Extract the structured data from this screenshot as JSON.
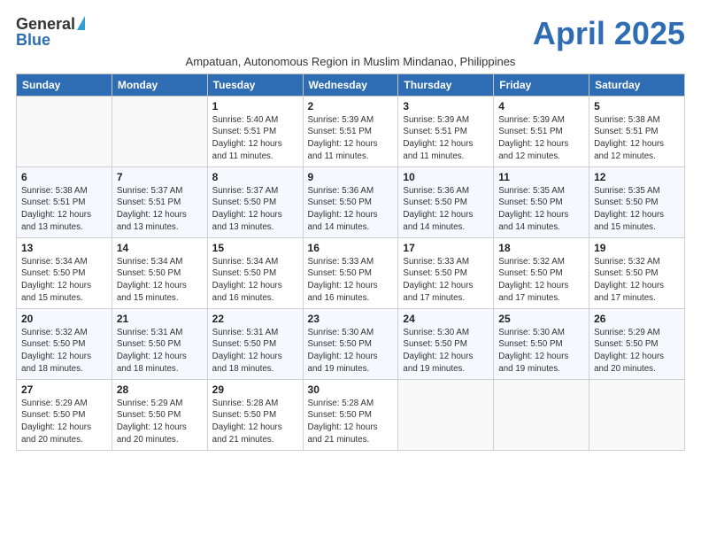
{
  "logo": {
    "general": "General",
    "blue": "Blue"
  },
  "header": {
    "month_title": "April 2025",
    "subtitle": "Ampatuan, Autonomous Region in Muslim Mindanao, Philippines"
  },
  "days_of_week": [
    "Sunday",
    "Monday",
    "Tuesday",
    "Wednesday",
    "Thursday",
    "Friday",
    "Saturday"
  ],
  "weeks": [
    [
      {
        "day": "",
        "info": ""
      },
      {
        "day": "",
        "info": ""
      },
      {
        "day": "1",
        "info": "Sunrise: 5:40 AM\nSunset: 5:51 PM\nDaylight: 12 hours and 11 minutes."
      },
      {
        "day": "2",
        "info": "Sunrise: 5:39 AM\nSunset: 5:51 PM\nDaylight: 12 hours and 11 minutes."
      },
      {
        "day": "3",
        "info": "Sunrise: 5:39 AM\nSunset: 5:51 PM\nDaylight: 12 hours and 11 minutes."
      },
      {
        "day": "4",
        "info": "Sunrise: 5:39 AM\nSunset: 5:51 PM\nDaylight: 12 hours and 12 minutes."
      },
      {
        "day": "5",
        "info": "Sunrise: 5:38 AM\nSunset: 5:51 PM\nDaylight: 12 hours and 12 minutes."
      }
    ],
    [
      {
        "day": "6",
        "info": "Sunrise: 5:38 AM\nSunset: 5:51 PM\nDaylight: 12 hours and 13 minutes."
      },
      {
        "day": "7",
        "info": "Sunrise: 5:37 AM\nSunset: 5:51 PM\nDaylight: 12 hours and 13 minutes."
      },
      {
        "day": "8",
        "info": "Sunrise: 5:37 AM\nSunset: 5:50 PM\nDaylight: 12 hours and 13 minutes."
      },
      {
        "day": "9",
        "info": "Sunrise: 5:36 AM\nSunset: 5:50 PM\nDaylight: 12 hours and 14 minutes."
      },
      {
        "day": "10",
        "info": "Sunrise: 5:36 AM\nSunset: 5:50 PM\nDaylight: 12 hours and 14 minutes."
      },
      {
        "day": "11",
        "info": "Sunrise: 5:35 AM\nSunset: 5:50 PM\nDaylight: 12 hours and 14 minutes."
      },
      {
        "day": "12",
        "info": "Sunrise: 5:35 AM\nSunset: 5:50 PM\nDaylight: 12 hours and 15 minutes."
      }
    ],
    [
      {
        "day": "13",
        "info": "Sunrise: 5:34 AM\nSunset: 5:50 PM\nDaylight: 12 hours and 15 minutes."
      },
      {
        "day": "14",
        "info": "Sunrise: 5:34 AM\nSunset: 5:50 PM\nDaylight: 12 hours and 15 minutes."
      },
      {
        "day": "15",
        "info": "Sunrise: 5:34 AM\nSunset: 5:50 PM\nDaylight: 12 hours and 16 minutes."
      },
      {
        "day": "16",
        "info": "Sunrise: 5:33 AM\nSunset: 5:50 PM\nDaylight: 12 hours and 16 minutes."
      },
      {
        "day": "17",
        "info": "Sunrise: 5:33 AM\nSunset: 5:50 PM\nDaylight: 12 hours and 17 minutes."
      },
      {
        "day": "18",
        "info": "Sunrise: 5:32 AM\nSunset: 5:50 PM\nDaylight: 12 hours and 17 minutes."
      },
      {
        "day": "19",
        "info": "Sunrise: 5:32 AM\nSunset: 5:50 PM\nDaylight: 12 hours and 17 minutes."
      }
    ],
    [
      {
        "day": "20",
        "info": "Sunrise: 5:32 AM\nSunset: 5:50 PM\nDaylight: 12 hours and 18 minutes."
      },
      {
        "day": "21",
        "info": "Sunrise: 5:31 AM\nSunset: 5:50 PM\nDaylight: 12 hours and 18 minutes."
      },
      {
        "day": "22",
        "info": "Sunrise: 5:31 AM\nSunset: 5:50 PM\nDaylight: 12 hours and 18 minutes."
      },
      {
        "day": "23",
        "info": "Sunrise: 5:30 AM\nSunset: 5:50 PM\nDaylight: 12 hours and 19 minutes."
      },
      {
        "day": "24",
        "info": "Sunrise: 5:30 AM\nSunset: 5:50 PM\nDaylight: 12 hours and 19 minutes."
      },
      {
        "day": "25",
        "info": "Sunrise: 5:30 AM\nSunset: 5:50 PM\nDaylight: 12 hours and 19 minutes."
      },
      {
        "day": "26",
        "info": "Sunrise: 5:29 AM\nSunset: 5:50 PM\nDaylight: 12 hours and 20 minutes."
      }
    ],
    [
      {
        "day": "27",
        "info": "Sunrise: 5:29 AM\nSunset: 5:50 PM\nDaylight: 12 hours and 20 minutes."
      },
      {
        "day": "28",
        "info": "Sunrise: 5:29 AM\nSunset: 5:50 PM\nDaylight: 12 hours and 20 minutes."
      },
      {
        "day": "29",
        "info": "Sunrise: 5:28 AM\nSunset: 5:50 PM\nDaylight: 12 hours and 21 minutes."
      },
      {
        "day": "30",
        "info": "Sunrise: 5:28 AM\nSunset: 5:50 PM\nDaylight: 12 hours and 21 minutes."
      },
      {
        "day": "",
        "info": ""
      },
      {
        "day": "",
        "info": ""
      },
      {
        "day": "",
        "info": ""
      }
    ]
  ]
}
